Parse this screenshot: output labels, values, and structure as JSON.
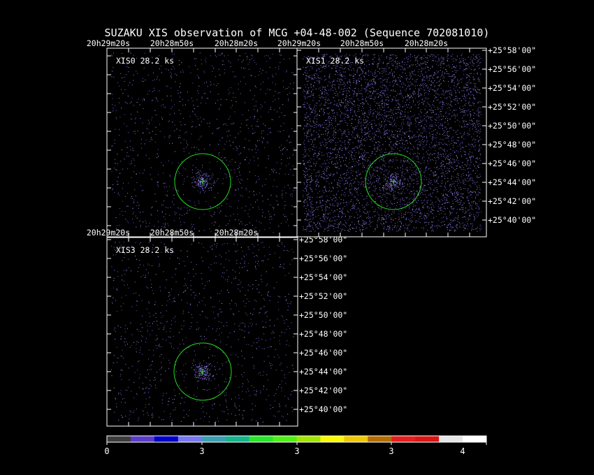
{
  "title": "SUZAKU XIS observation of MCG +04-48-002  (Sequence 702081010)",
  "ra_labels_top": [
    "20h29m20s",
    "20h28m50s",
    "20h28m20s",
    "20h29m20s",
    "20h28m50s",
    "20h28m20s"
  ],
  "ra_labels_mid": [
    "20h29m20s",
    "20h28m50s",
    "20h28m20s"
  ],
  "panels": [
    {
      "id": "xis0",
      "label": "XIS0 28.2 ks"
    },
    {
      "id": "xis1",
      "label": "XIS1 28.2 ks"
    },
    {
      "id": "xis3",
      "label": "XIS3 28.2 ks"
    }
  ],
  "dec_labels_xis1": [
    "+25°58'00\"",
    "+25°56'00\"",
    "+25°54'00\"",
    "+25°52'00\"",
    "+25°50'00\"",
    "+25°48'00\"",
    "+25°46'00\"",
    "+25°44'00\"",
    "+25°42'00\"",
    "+25°40'00\""
  ],
  "dec_labels_xis3": [
    "+25°58'00\"",
    "+25°56'00\"",
    "+25°54'00\"",
    "+25°52'00\"",
    "+25°50'00\"",
    "+25°48'00\"",
    "+25°46'00\"",
    "+25°44'00\"",
    "+25°42'00\"",
    "+25°40'00\""
  ],
  "colorbar": {
    "colors": [
      "#3c3c3c",
      "#5a3cc8",
      "#0000c8",
      "#7878f0",
      "#3ca0b4",
      "#14b48c",
      "#28e628",
      "#50f014",
      "#a0e600",
      "#fafa00",
      "#f0c800",
      "#b46e00",
      "#e61e1e",
      "#dc1414",
      "#e6e6e6",
      "#ffffff"
    ],
    "tick_labels": [
      "0",
      "3",
      "3",
      "3",
      "4"
    ]
  },
  "colors": {
    "frame": "#ffffff",
    "region": "#22dd22",
    "source_marker": "#22dd22"
  }
}
